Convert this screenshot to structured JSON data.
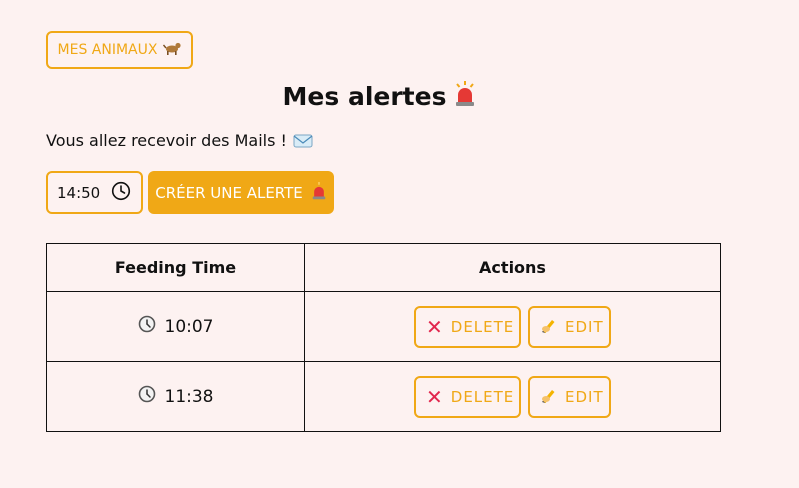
{
  "nav": {
    "animals_button_label": "MES ANIMAUX",
    "animals_icon": "dog-icon"
  },
  "header": {
    "title": "Mes alertes",
    "title_icon": "siren-icon",
    "subtitle": "Vous allez recevoir des Mails !",
    "subtitle_icon": "envelope-icon"
  },
  "form": {
    "time_value": "14:50",
    "create_button_label": "CRÉER UNE ALERTE",
    "create_icon": "siren-icon"
  },
  "table": {
    "headers": [
      "Feeding Time",
      "Actions"
    ],
    "rows": [
      {
        "time": "10:07",
        "delete_label": "DELETE",
        "edit_label": "EDIT"
      },
      {
        "time": "11:38",
        "delete_label": "DELETE",
        "edit_label": "EDIT"
      }
    ]
  },
  "colors": {
    "accent": "#f0a816",
    "background": "#fdf2f1",
    "delete_icon": "#e2264d"
  }
}
